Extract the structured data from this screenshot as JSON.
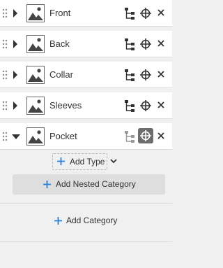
{
  "categories": [
    {
      "label": "Front",
      "expanded": false,
      "target_active": false
    },
    {
      "label": "Back",
      "expanded": false,
      "target_active": false
    },
    {
      "label": "Collar",
      "expanded": false,
      "target_active": false
    },
    {
      "label": "Sleeves",
      "expanded": false,
      "target_active": false
    },
    {
      "label": "Pocket",
      "expanded": true,
      "target_active": true
    }
  ],
  "nested": {
    "add_type_label": "Add Type",
    "add_nested_label": "Add Nested Category"
  },
  "add_category_label": "Add Category",
  "icons": {
    "drag": "drag-handle-icon",
    "caret": "caret-icon",
    "thumbnail": "image-placeholder-icon",
    "tree": "hierarchy-icon",
    "target": "crosshair-icon",
    "close": "close-icon",
    "plus": "plus-icon",
    "chevron": "chevron-down-icon"
  },
  "colors": {
    "accent": "#2a7fd4",
    "active_tool_bg": "#6d6d6d",
    "icon": "#333333",
    "row_bg": "#ffffff",
    "panel_bg": "#f0f0f0",
    "button_bg": "#dedede"
  }
}
